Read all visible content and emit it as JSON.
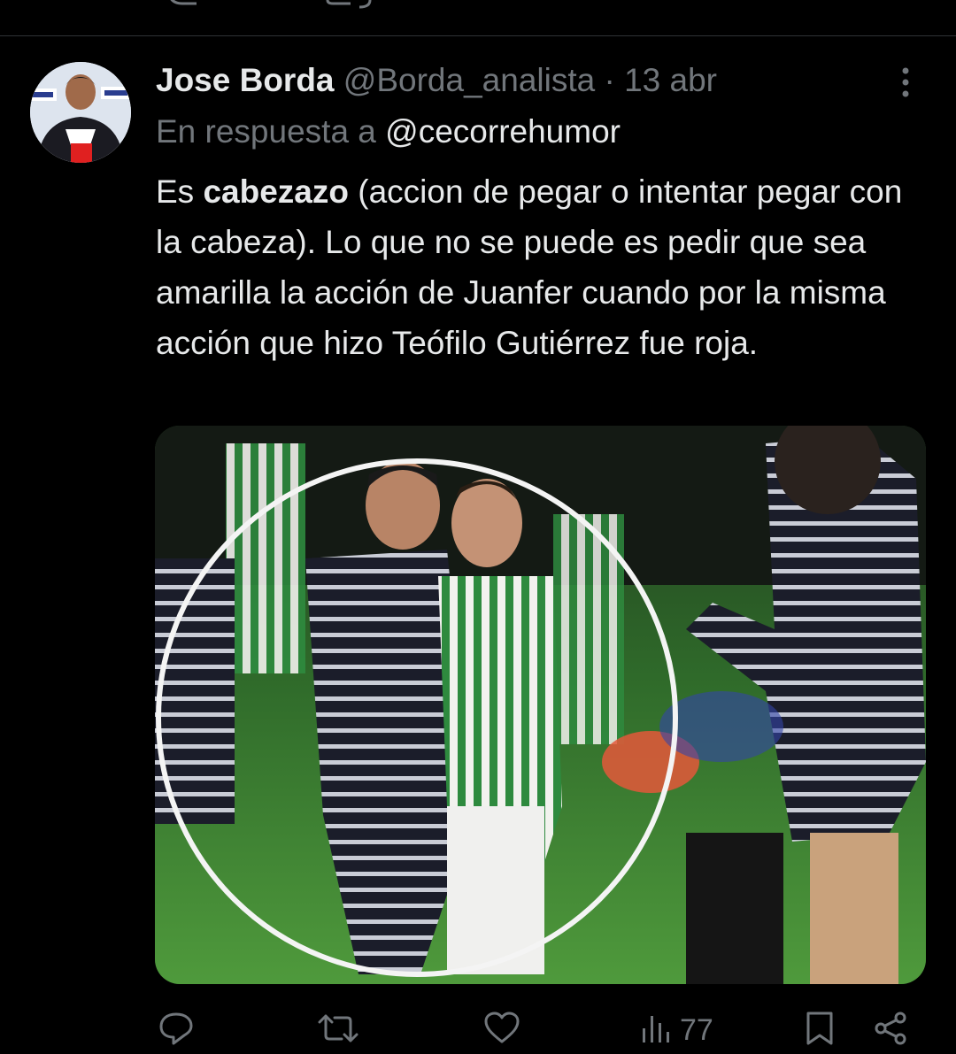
{
  "tweet": {
    "author_name": "Jose Borda",
    "author_handle": "@Borda_analista",
    "separator": "·",
    "date": "13 abr",
    "reply_prefix": "En respuesta a",
    "reply_to": "@cecorrehumor",
    "text_part1": "Es ",
    "text_bold": "cabezazo",
    "text_part2": " (accion de pegar o intentar pegar con la cabeza). Lo que no se puede es pedir que sea amarilla la acción de Juanfer cuando por la misma acción que hizo  Teófilo Gutiérrez fue roja.",
    "views": "77"
  },
  "icons": {
    "more": "more-vertical-icon",
    "reply": "reply-icon",
    "retweet": "retweet-icon",
    "like": "heart-icon",
    "views": "analytics-icon",
    "bookmark": "bookmark-icon",
    "share": "share-icon"
  },
  "colors": {
    "background": "#000000",
    "text": "#e7e9ea",
    "secondary": "#71767b",
    "divider": "#2f3336"
  }
}
